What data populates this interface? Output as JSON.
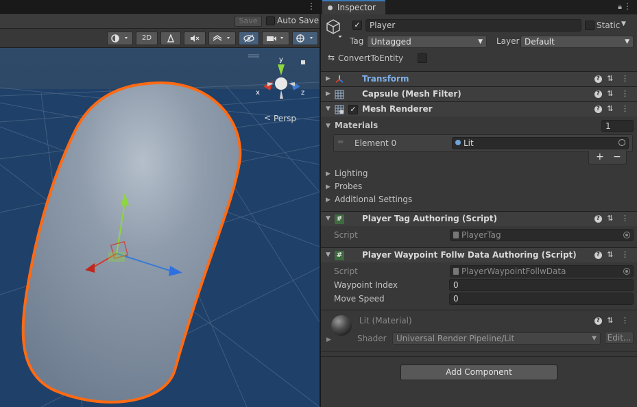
{
  "scene": {
    "save_label": "Save",
    "autosave_label": "Auto Save",
    "toolbar": {
      "mode_2d_label": "2D"
    },
    "gizmo": {
      "axis_x": "x",
      "axis_y": "y",
      "axis_z": "z",
      "persp_label": "Persp"
    }
  },
  "inspector": {
    "tab_label": "Inspector",
    "object_name": "Player",
    "static_label": "Static",
    "tag_label": "Tag",
    "tag_value": "Untagged",
    "layer_label": "Layer",
    "layer_value": "Default",
    "convert_label": "ConvertToEntity",
    "components": {
      "transform": "Transform",
      "mesh_filter": "Capsule (Mesh Filter)",
      "mesh_renderer": "Mesh Renderer",
      "player_tag": "Player Tag Authoring (Script)",
      "waypoint": "Player Waypoint Follw Data Authoring (Script)"
    },
    "materials": {
      "label": "Materials",
      "count": "1",
      "element_label": "Element 0",
      "element_value": "Lit",
      "plus": "+",
      "minus": "−"
    },
    "lighting_label": "Lighting",
    "probes_label": "Probes",
    "additional_label": "Additional Settings",
    "player_tag_script_label": "Script",
    "player_tag_script_value": "PlayerTag",
    "waypoint_script_label": "Script",
    "waypoint_script_value": "PlayerWaypointFollwData",
    "waypoint_index_label": "Waypoint Index",
    "waypoint_index_value": "0",
    "move_speed_label": "Move Speed",
    "move_speed_value": "0",
    "material_preview": {
      "title": "Lit (Material)",
      "shader_label": "Shader",
      "shader_value": "Universal Render Pipeline/Lit",
      "edit_label": "Edit..."
    },
    "add_component_label": "Add Component"
  },
  "colors": {
    "selection_outline": "#ff6a13",
    "axis_x": "#d33b2c",
    "axis_y": "#8ed63d",
    "axis_z": "#3a7bd5",
    "transform_title": "#7fb0ea"
  }
}
